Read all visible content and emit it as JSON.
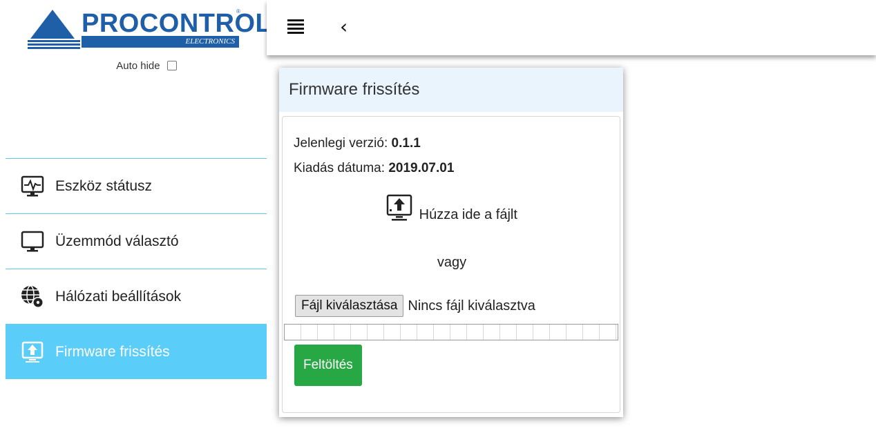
{
  "brand": {
    "name": "PROCONTROL",
    "tagline": "ELECTRONICS",
    "registered": "®"
  },
  "sidebar": {
    "auto_hide_label": "Auto hide",
    "auto_hide_checked": false,
    "items": [
      {
        "label": "Eszköz státusz",
        "icon": "monitor-pulse-icon",
        "active": false
      },
      {
        "label": "Üzemmód választó",
        "icon": "monitor-icon",
        "active": false
      },
      {
        "label": "Hálózati beállítások",
        "icon": "globe-gear-icon",
        "active": false
      },
      {
        "label": "Firmware frissítés",
        "icon": "upload-monitor-icon",
        "active": true
      }
    ]
  },
  "topbar": {
    "menu_icon": "hamburger-icon",
    "back_icon": "chevron-left-icon",
    "back_glyph": "‹"
  },
  "card": {
    "title": "Firmware frissítés",
    "version_label": "Jelenlegi verzió:",
    "version_value": "0.1.1",
    "date_label": "Kiadás dátuma:",
    "date_value": "2019.07.01",
    "drop_text": "Húzza ide a fájlt",
    "or_text": "vagy",
    "file_button_label": "Fájl kiválasztása",
    "file_status": "Nincs fájl kiválasztva",
    "progress_percent": 0,
    "upload_label": "Feltöltés"
  },
  "colors": {
    "accent": "#5bcdf9",
    "brand_blue": "#1f5fa8",
    "upload_green": "#28a745",
    "header_bg": "#e9f4fd"
  }
}
